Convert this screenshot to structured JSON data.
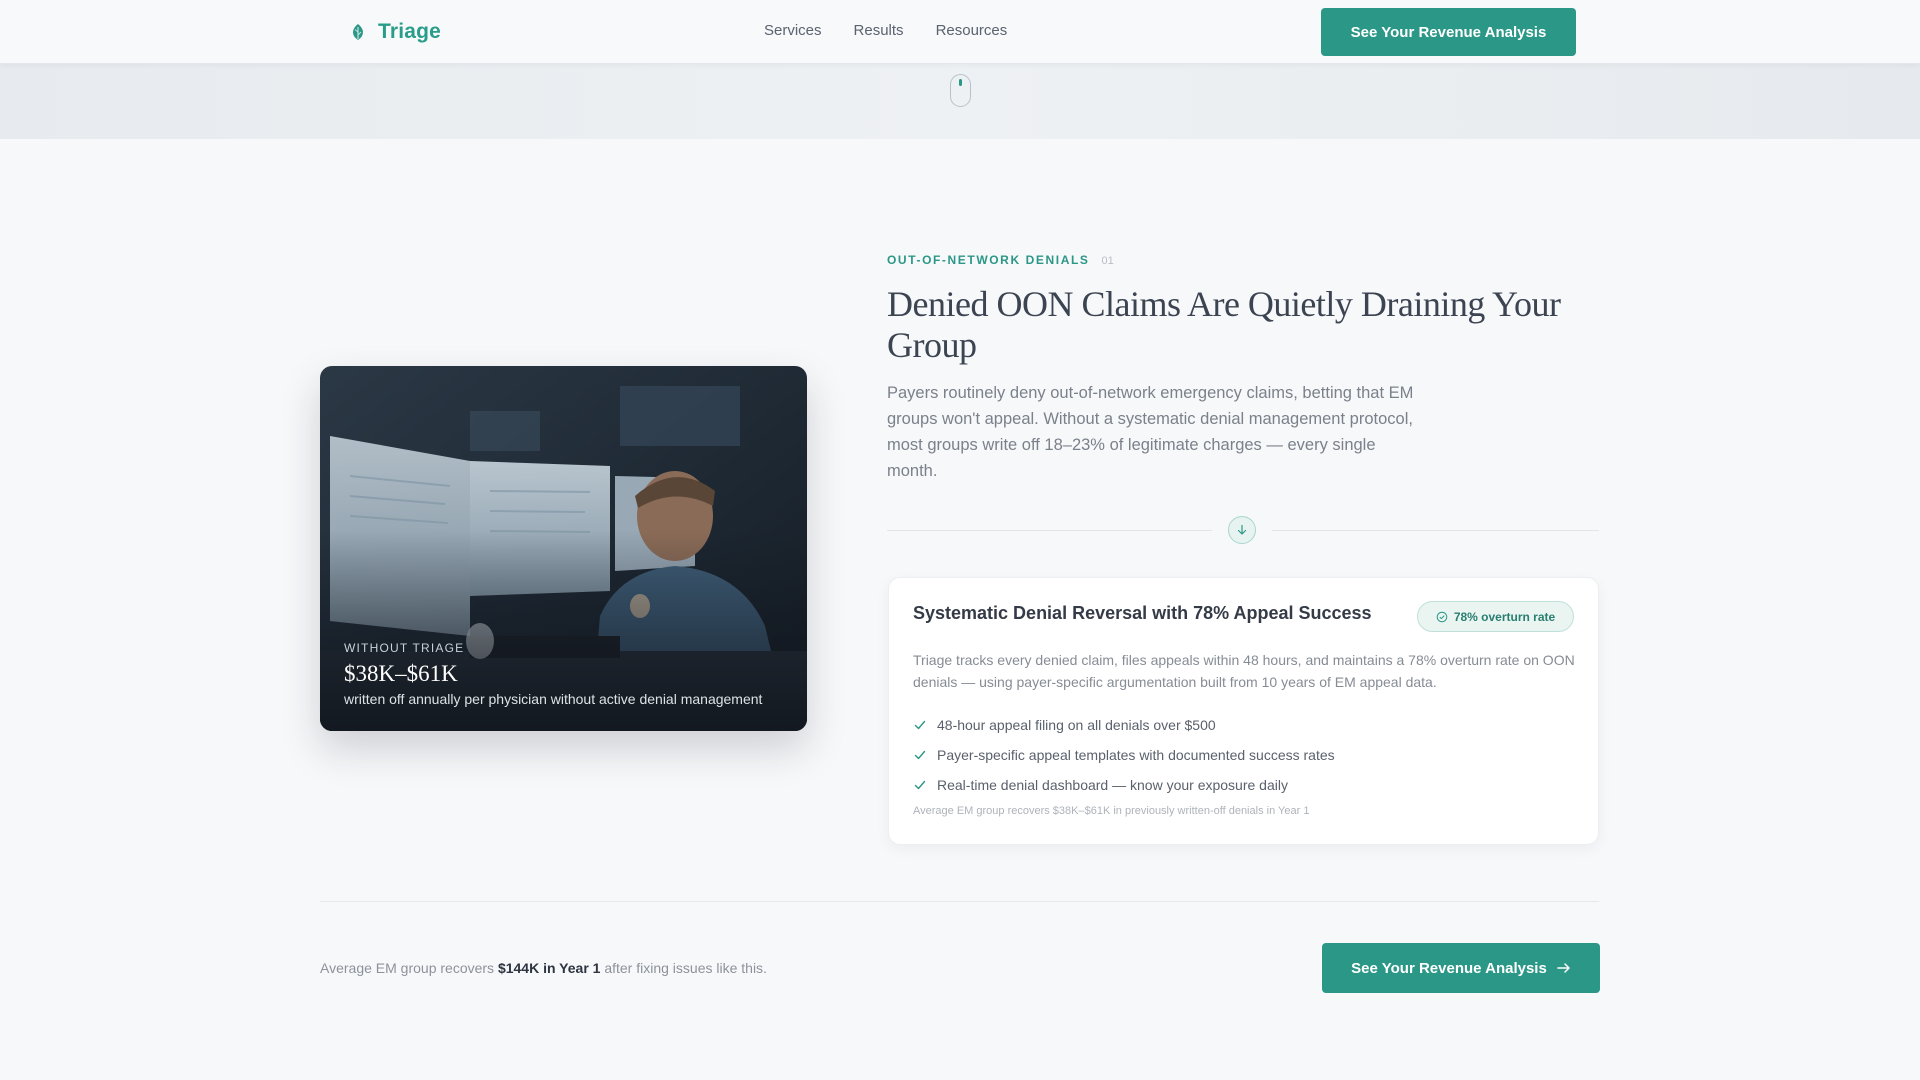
{
  "brand": {
    "name": "Triage",
    "accent": "#2b9787",
    "icon": "leaf-icon"
  },
  "nav": {
    "links": [
      "Services",
      "Results",
      "Resources"
    ],
    "cta": "See Your Revenue Analysis"
  },
  "hero": {
    "scroll_icon": "mouse-scroll-icon"
  },
  "image_card": {
    "label": "WITHOUT TRIAGE",
    "value": "$38K–$61K",
    "caption": "written off annually per physician without active denial management"
  },
  "section": {
    "eyebrow": "OUT-OF-NETWORK DENIALS",
    "number": "01",
    "headline": "Denied OON Claims Are Quietly Draining Your Group",
    "lead": "Payers routinely deny out-of-network emergency claims, betting that EM groups won't appeal. Without a systematic denial management protocol, most groups write off 18–23% of legitimate charges — every single month.",
    "divider_icon": "arrow-down-icon"
  },
  "solution": {
    "title": "Systematic Denial Reversal with 78% Appeal Success",
    "badge": "78% overturn rate",
    "description": "Triage tracks every denied claim, files appeals within 48 hours, and maintains a 78% overturn rate on OON denials — using payer-specific argumentation built from 10 years of EM appeal data.",
    "items": [
      "48-hour appeal filing on all denials over $500",
      "Payer-specific appeal templates with documented success rates",
      "Real-time denial dashboard — know your exposure daily"
    ],
    "footnote": "Average EM group recovers $38K–$61K in previously written-off denials in Year 1"
  },
  "bottom": {
    "text_before": "Average EM group recovers ",
    "text_bold": "$144K in Year 1",
    "text_after": " after fixing issues like this.",
    "cta": "See Your Revenue Analysis"
  }
}
